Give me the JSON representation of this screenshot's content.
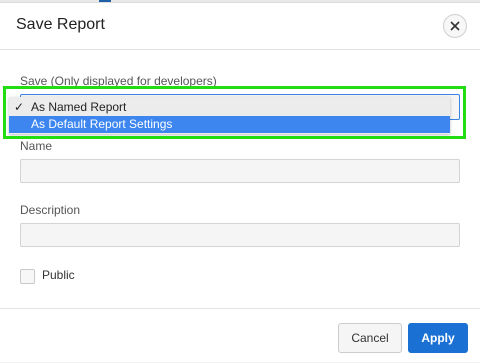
{
  "dialog": {
    "title": "Save Report",
    "close_icon": "close-icon"
  },
  "form": {
    "save_label": "Save (Only displayed for developers)",
    "save_options": [
      {
        "label": "As Named Report",
        "checked": true
      },
      {
        "label": "As Default Report Settings",
        "highlighted": true
      }
    ],
    "name_label": "Name",
    "name_value": "",
    "description_label": "Description",
    "description_value": "",
    "public_label": "Public",
    "public_checked": false
  },
  "footer": {
    "cancel_label": "Cancel",
    "apply_label": "Apply"
  },
  "colors": {
    "accent": "#1b71d3",
    "highlight": "#3d86f0",
    "focus_ring": "#22dd11"
  }
}
